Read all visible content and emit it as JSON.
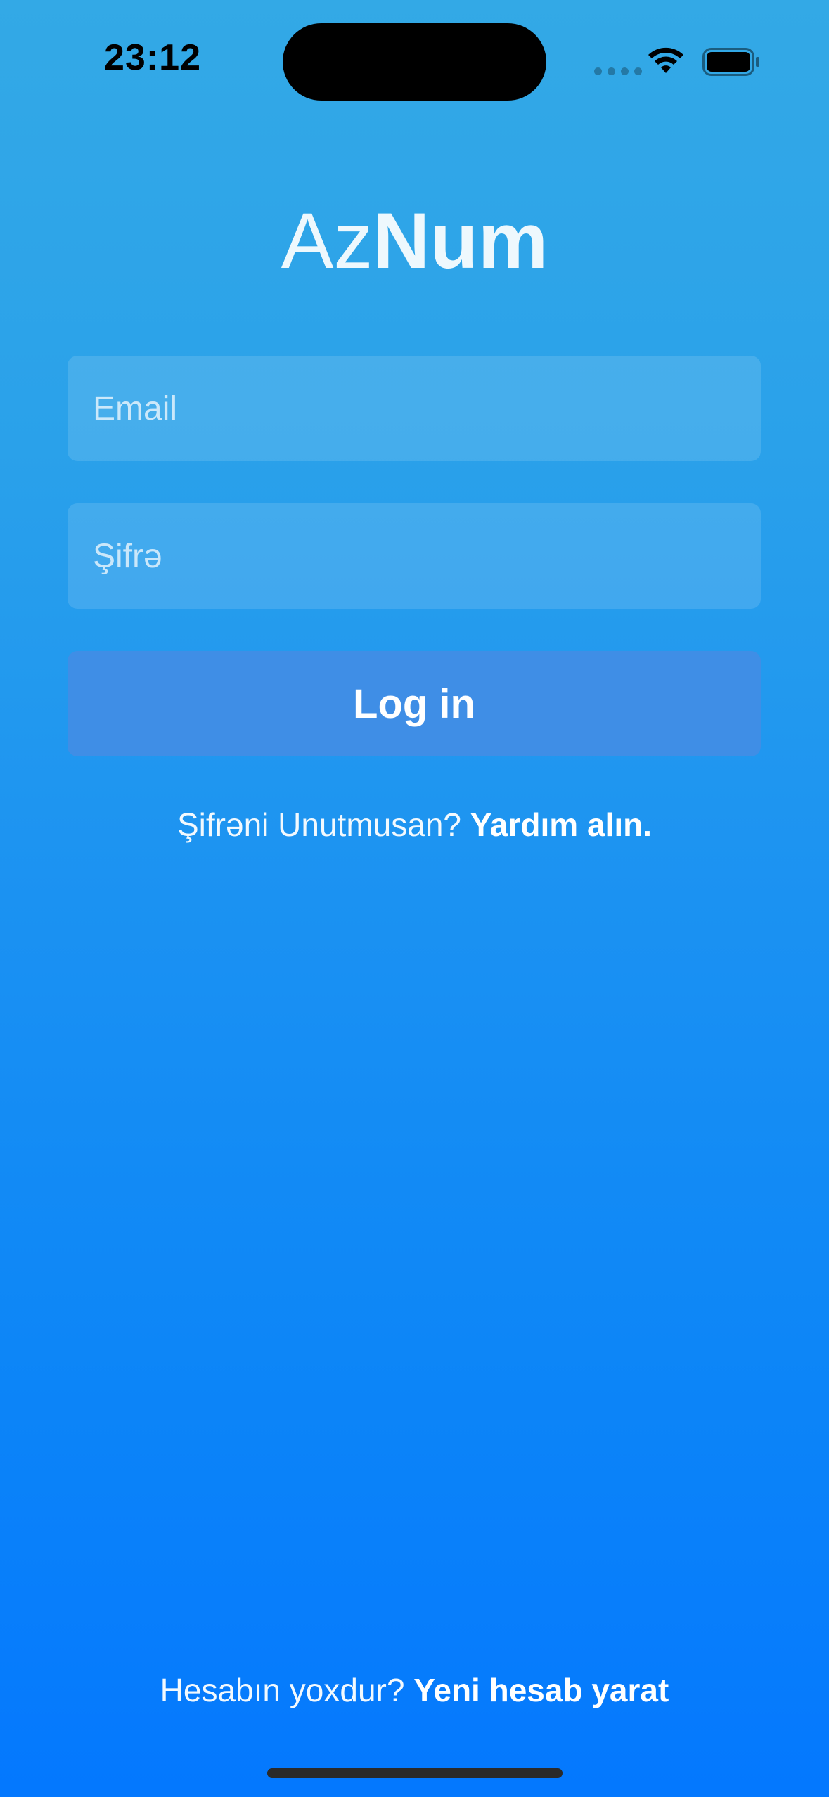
{
  "status_bar": {
    "time": "23:12",
    "icons": [
      "cellular-signal-icon",
      "wifi-icon",
      "battery-icon"
    ]
  },
  "header": {
    "title_part1": "Az",
    "title_part2": "Num"
  },
  "form": {
    "email_placeholder": "Email",
    "email_value": "",
    "password_placeholder": "Şifrə",
    "password_value": "",
    "login_label": "Log in"
  },
  "help": {
    "forgot_text": "Şifrəni Unutmusan?",
    "forgot_link": "Yardım alın."
  },
  "footer": {
    "no_account_text": "Hesabın yoxdur?",
    "signup_link": "Yeni hesab yarat"
  },
  "colors": {
    "gradient_top": "#33a9e6",
    "gradient_bottom": "#0478fe",
    "button_bg": "#3f8ee6",
    "text": "#ffffff"
  }
}
